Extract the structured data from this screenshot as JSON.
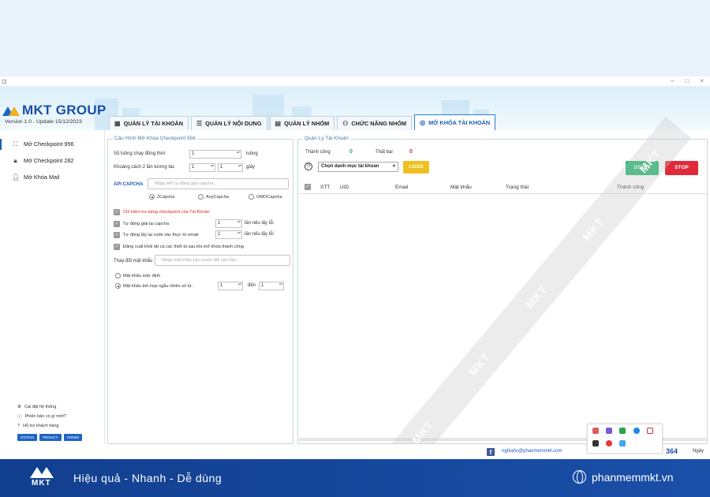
{
  "window": {
    "minimize": "–",
    "maximize": "□",
    "close": "×"
  },
  "brand": {
    "logo_text": "MKT GROUP",
    "version": "Version   1.0   - Update  15/12/2023"
  },
  "tabs": [
    {
      "label": "QUẢN LÝ TÀI KHOẢN",
      "icon": "grid-icon"
    },
    {
      "label": "QUẢN LÝ NỘI DUNG",
      "icon": "list-icon"
    },
    {
      "label": "QUẢN LÝ NHÓM",
      "icon": "group-icon"
    },
    {
      "label": "CHỨC NĂNG NHÓM",
      "icon": "team-icon"
    },
    {
      "label": "MỞ KHÓA TÀI KHOẢN",
      "icon": "fingerprint-icon",
      "active": true
    }
  ],
  "sidebar": {
    "items": [
      {
        "label": "Mở Checkpoint 956",
        "icon": "scan-icon"
      },
      {
        "label": "Mở Checkpoint 282",
        "icon": "lock-icon"
      },
      {
        "label": "Mở Khóa Mail",
        "icon": "user-icon"
      }
    ],
    "links": [
      "Cài đặt hệ thống",
      "Phiên bản có gì mới?",
      "Hỗ trợ khách hàng"
    ],
    "buttons": [
      "STATUS",
      "PRIVACY",
      "TERMS"
    ]
  },
  "config": {
    "title": "Cấu Hình Mở Khóa Checkpoint 956",
    "threads_label": "Số luồng chạy đồng thời",
    "threads_value": "1",
    "threads_unit": "luồng",
    "interval_label": "Khoảng cách 2 lần tương tác",
    "interval_from": "1",
    "interval_to": "1",
    "interval_unit": "giây",
    "api_label": "API CAPCHA",
    "api_placeholder": "Nhập API tự động giải capcha...",
    "captcha_options": [
      "2Capcha",
      "AnyCapcha",
      "OMOCapcha"
    ],
    "captcha_selected": 0,
    "only_check_label": "Chỉ kiểm tra dạng checkpoint của Tài Khoản",
    "retry_captcha_label": "Tự động giải lại capcha",
    "retry_captcha_value": "1",
    "retry_captcha_unit": "lần nếu lấy lỗi",
    "retry_email_label": "Tự động lấy lại code xác thực từ email",
    "retry_email_value": "1",
    "retry_email_unit": "lần nếu lấy lỗi",
    "logout_label": "Đăng xuất khỏi tất cả các thiết bị sau khi mở khóa thành công",
    "password_label": "Thay đổi mật khẩu",
    "password_placeholder": "Nhập mật khẩu bạn muốn đổi vào đây...",
    "password_default": "Mật khẩu mặc định",
    "password_random": "Mật khẩu kết hợp ngẫu nhiên số từ :",
    "random_from": "1",
    "random_to_label": "đến",
    "random_to": "1"
  },
  "accounts": {
    "title": "Quản Lý Tài Khoản",
    "success_label": "Thành công",
    "success_value": "0",
    "fail_label": "Thất bại",
    "fail_value": "0",
    "category_select": "Chọn danh mục tài khoản",
    "load_button": "LOAD",
    "start_button": "START",
    "stop_button": "STOP",
    "columns": [
      "STT",
      "UID",
      "Email",
      "Mật khẩu",
      "Trạng thái",
      "Thành công"
    ]
  },
  "status": {
    "email": "nghiahc@phanmemmkt.com",
    "count": "364",
    "unit": "Ngày"
  },
  "watermark": "MKT",
  "footer": {
    "logo": "MKT",
    "slogan": "Hiệu quả - Nhanh - Dễ dùng",
    "site": "phanmemmkt.vn"
  },
  "colors": {
    "primary": "#1a4fa8",
    "accent": "#f0b020",
    "start": "#1fb46b",
    "stop": "#e02a3a",
    "load": "#f0c020"
  }
}
